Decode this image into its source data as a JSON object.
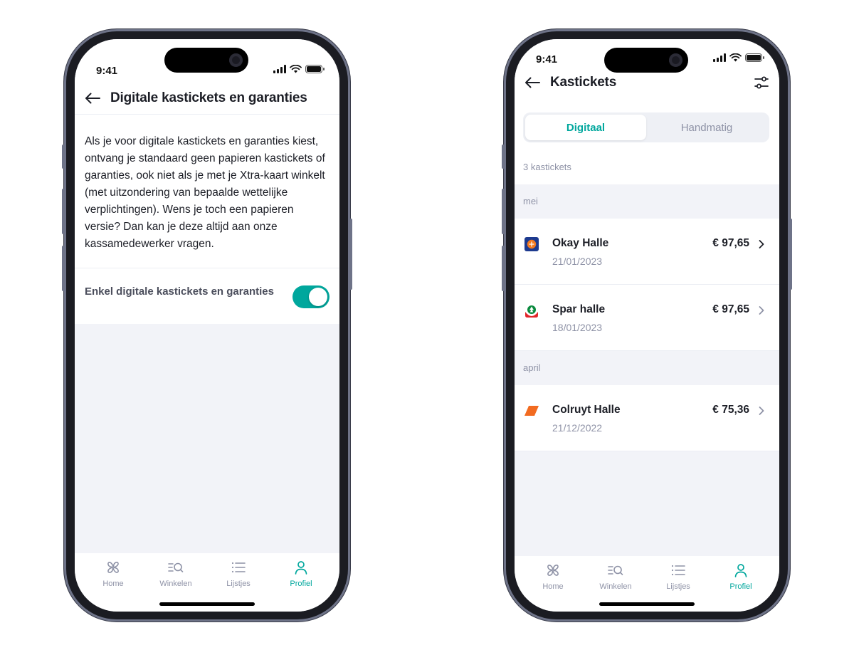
{
  "status_bar": {
    "time": "9:41"
  },
  "screen_1": {
    "title": "Digitale kastickets en garanties",
    "body_text": "Als je voor digitale kastickets en garanties kiest, ontvang je standaard geen papieren kastickets of garanties, ook niet als je met je Xtra-kaart winkelt (met uitzondering van bepaalde wettelijke verplichtingen). Wens je toch een papieren versie? Dan kan je deze altijd aan onze kassamedewerker vragen.",
    "toggle": {
      "label": "Enkel digitale kastickets en garanties",
      "on": true
    }
  },
  "screen_2": {
    "title": "Kastickets",
    "segments": [
      {
        "label": "Digitaal",
        "active": true
      },
      {
        "label": "Handmatig",
        "active": false
      }
    ],
    "count_label": "3 kastickets",
    "groups": [
      {
        "month": "mei",
        "receipts": [
          {
            "store": "Okay Halle",
            "date": "21/01/2023",
            "amount": "€ 97,65",
            "logo": "okay-logo"
          },
          {
            "store": "Spar halle",
            "date": "18/01/2023",
            "amount": "€ 97,65",
            "logo": "spar-logo"
          }
        ]
      },
      {
        "month": "april",
        "receipts": [
          {
            "store": "Colruyt Halle",
            "date": "21/12/2022",
            "amount": "€ 75,36",
            "logo": "colruyt-logo"
          }
        ]
      }
    ]
  },
  "tab_bar": {
    "items": [
      {
        "label": "Home",
        "icon": "home-icon"
      },
      {
        "label": "Winkelen",
        "icon": "search-list-icon"
      },
      {
        "label": "Lijstjes",
        "icon": "list-icon"
      },
      {
        "label": "Profiel",
        "icon": "profile-icon",
        "active": true
      }
    ]
  },
  "colors": {
    "accent": "#00a79d",
    "text": "#1c1e26",
    "muted": "#8e92a6",
    "background": "#f2f3f8"
  }
}
